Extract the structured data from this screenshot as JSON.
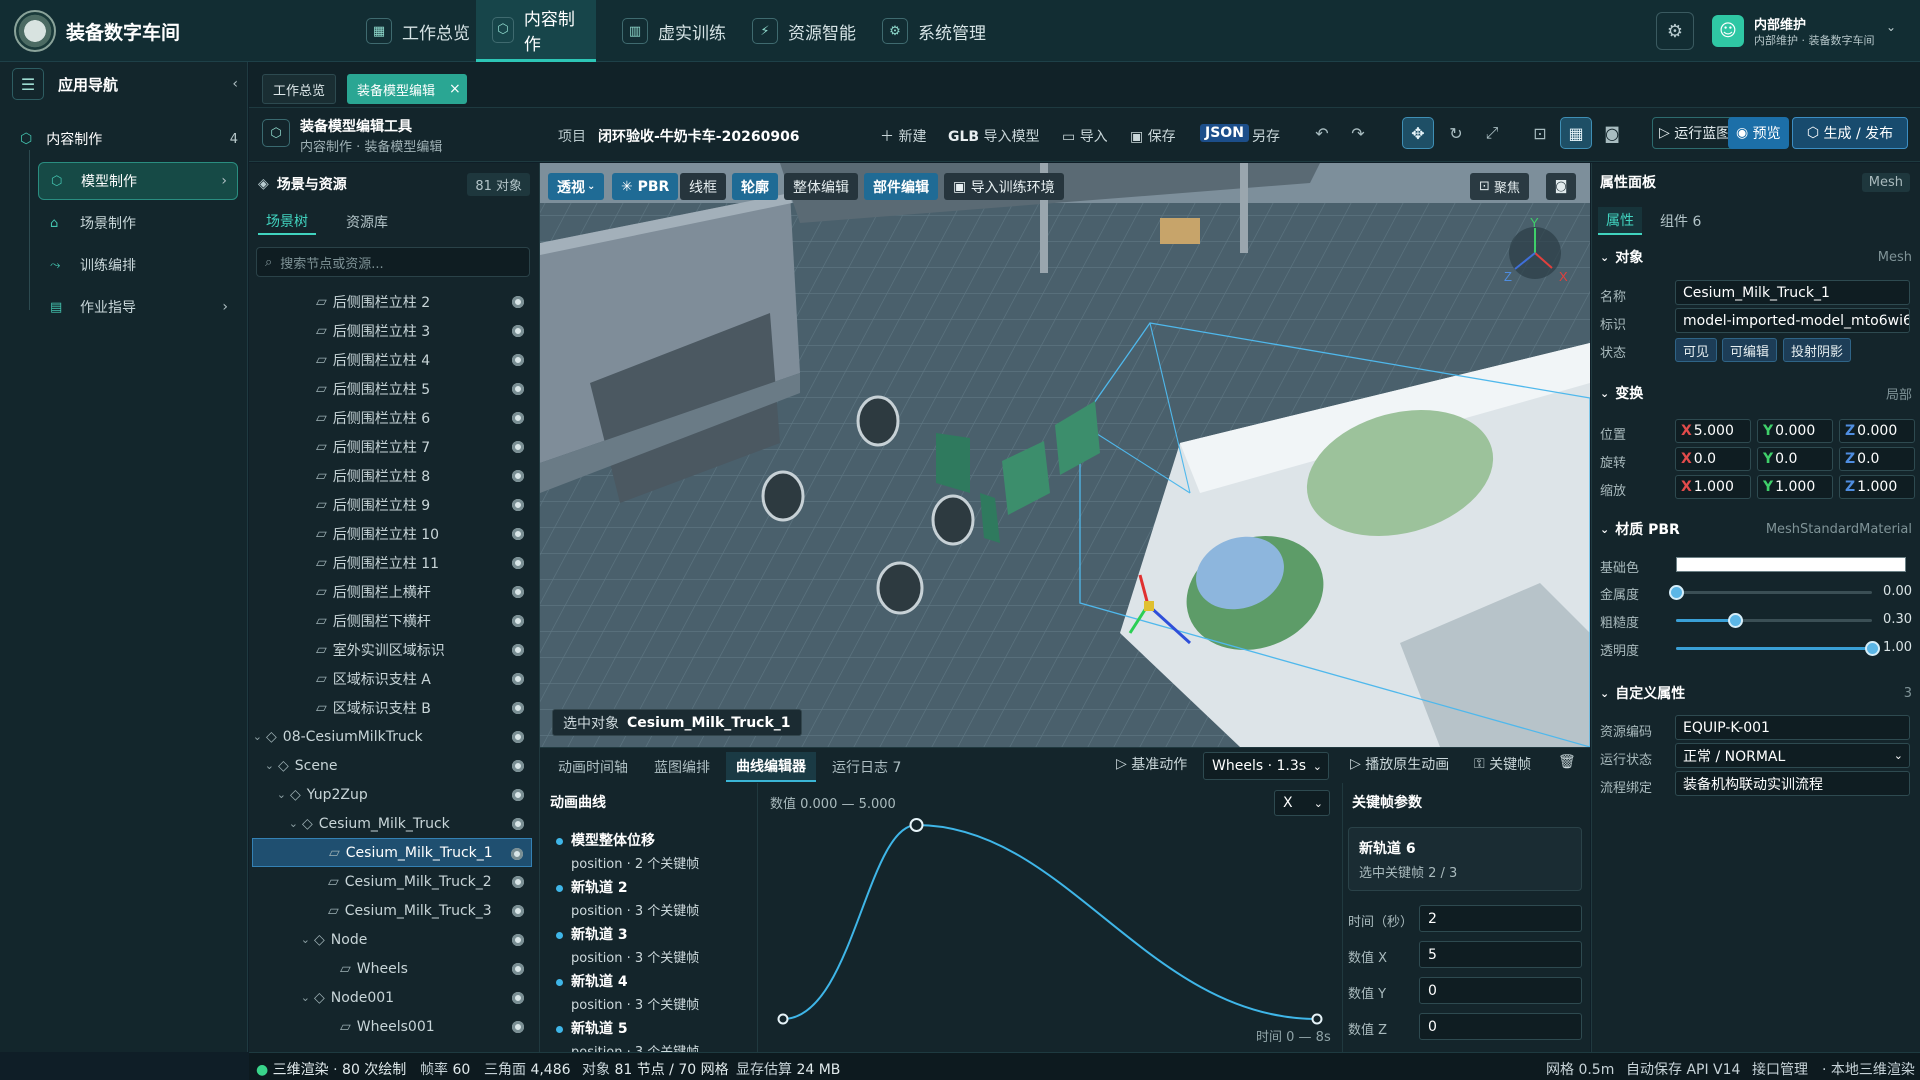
{
  "app": {
    "title": "装备数字车间"
  },
  "topnav": [
    {
      "label": "工作总览",
      "icon": "grid-icon"
    },
    {
      "label": "内容制作",
      "icon": "cube-icon",
      "active": true
    },
    {
      "label": "虚实训练",
      "icon": "book-icon"
    },
    {
      "label": "资源智能",
      "icon": "plug-icon"
    },
    {
      "label": "系统管理",
      "icon": "gear-icon"
    }
  ],
  "user": {
    "name": "内部维护",
    "subtitle": "内部维护 · 装备数字车间"
  },
  "sidebar": {
    "title": "应用导航",
    "section": {
      "label": "内容制作",
      "count": "4"
    },
    "items": [
      {
        "label": "模型制作",
        "icon": "cube-icon"
      },
      {
        "label": "场景制作",
        "icon": "bank-icon"
      },
      {
        "label": "训练编排",
        "icon": "flow-icon"
      },
      {
        "label": "作业指导",
        "icon": "document-icon"
      }
    ]
  },
  "tabs": {
    "overview": "工作总览",
    "editor": "装备模型编辑"
  },
  "toolbar": {
    "title": "装备模型编辑工具",
    "breadcrumb": "内容制作 · 装备模型编辑",
    "project_label": "项目",
    "project_name": "闭环验收-牛奶卡车-20260906",
    "new": "新建",
    "glb": "GLB",
    "import_model": "导入模型",
    "import": "导入",
    "save": "保存",
    "json": "JSON",
    "save_as": "另存",
    "run_blueprint": "运行蓝图",
    "preview": "预览",
    "publish": "生成 / 发布"
  },
  "scene": {
    "title": "场景与资源",
    "count": "81 对象",
    "tabs": [
      "场景树",
      "资源库"
    ],
    "search_placeholder": "搜索节点或资源...",
    "tree": [
      {
        "label": "后侧围栏立柱 2",
        "depth": 3,
        "icon": "▱"
      },
      {
        "label": "后侧围栏立柱 3",
        "depth": 3,
        "icon": "▱"
      },
      {
        "label": "后侧围栏立柱 4",
        "depth": 3,
        "icon": "▱"
      },
      {
        "label": "后侧围栏立柱 5",
        "depth": 3,
        "icon": "▱"
      },
      {
        "label": "后侧围栏立柱 6",
        "depth": 3,
        "icon": "▱"
      },
      {
        "label": "后侧围栏立柱 7",
        "depth": 3,
        "icon": "▱"
      },
      {
        "label": "后侧围栏立柱 8",
        "depth": 3,
        "icon": "▱"
      },
      {
        "label": "后侧围栏立柱 9",
        "depth": 3,
        "icon": "▱"
      },
      {
        "label": "后侧围栏立柱 10",
        "depth": 3,
        "icon": "▱"
      },
      {
        "label": "后侧围栏立柱 11",
        "depth": 3,
        "icon": "▱"
      },
      {
        "label": "后侧围栏上横杆",
        "depth": 3,
        "icon": "▱"
      },
      {
        "label": "后侧围栏下横杆",
        "depth": 3,
        "icon": "▱"
      },
      {
        "label": "室外实训区域标识",
        "depth": 3,
        "icon": "▱"
      },
      {
        "label": "区域标识支柱 A",
        "depth": 3,
        "icon": "▱"
      },
      {
        "label": "区域标识支柱 B",
        "depth": 3,
        "icon": "▱"
      },
      {
        "label": "08-CesiumMilkTruck",
        "depth": 0,
        "icon": "◇",
        "caret": "⌄"
      },
      {
        "label": "Scene",
        "depth": 1,
        "icon": "◇",
        "caret": "⌄"
      },
      {
        "label": "Yup2Zup",
        "depth": 2,
        "icon": "◇",
        "caret": "⌄"
      },
      {
        "label": "Cesium_Milk_Truck",
        "depth": 3,
        "icon": "◇",
        "caret": "⌄"
      },
      {
        "label": "Cesium_Milk_Truck_1",
        "depth": 4,
        "icon": "▱",
        "selected": true
      },
      {
        "label": "Cesium_Milk_Truck_2",
        "depth": 4,
        "icon": "▱"
      },
      {
        "label": "Cesium_Milk_Truck_3",
        "depth": 4,
        "icon": "▱"
      },
      {
        "label": "Node",
        "depth": 4,
        "icon": "◇",
        "caret": "⌄"
      },
      {
        "label": "Wheels",
        "depth": 5,
        "icon": "▱"
      },
      {
        "label": "Node001",
        "depth": 4,
        "icon": "◇",
        "caret": "⌄"
      },
      {
        "label": "Wheels001",
        "depth": 5,
        "icon": "▱"
      }
    ]
  },
  "viewport": {
    "buttons": [
      "透视",
      "PBR",
      "线框",
      "轮廓",
      "整体编辑",
      "部件编辑",
      "导入训练环境"
    ],
    "focus": "聚焦",
    "selected_label": "选中对象",
    "selected_name": "Cesium_Milk_Truck_1",
    "gizmo": {
      "y": "Y",
      "z": "Z",
      "x": "X"
    }
  },
  "dock": {
    "tabs": [
      "动画时间轴",
      "蓝图编排",
      "曲线编辑器",
      "运行日志 7"
    ],
    "base_action": "基准动作",
    "track_select": "Wheels · 1.3s",
    "play_native": "播放原生动画",
    "keyframe": "关键帧",
    "curves_title": "动画曲线",
    "curves": [
      {
        "name": "模型整体位移",
        "sub": "position · 2 个关键帧"
      },
      {
        "name": "新轨道 2",
        "sub": "position · 3 个关键帧"
      },
      {
        "name": "新轨道 3",
        "sub": "position · 3 个关键帧"
      },
      {
        "name": "新轨道 4",
        "sub": "position · 3 个关键帧"
      },
      {
        "name": "新轨道 5",
        "sub": "position · 3 个关键帧"
      }
    ],
    "range_label": "数值 0.000 — 5.000",
    "axis": "X",
    "time_label": "时间 0 — 8s",
    "kf_title": "关键帧参数",
    "kf_track": "新轨道 6",
    "kf_selected": "选中关键帧 2 / 3",
    "fields": [
      {
        "label": "时间（秒）",
        "value": "2"
      },
      {
        "label": "数值 X",
        "value": "5"
      },
      {
        "label": "数值 Y",
        "value": "0"
      },
      {
        "label": "数值 Z",
        "value": "0"
      }
    ]
  },
  "chart_data": {
    "type": "line",
    "x": [
      0,
      2,
      8
    ],
    "series": [
      {
        "values": [
          0,
          5,
          0
        ]
      }
    ],
    "xlim": [
      0,
      8
    ],
    "ylim": [
      0,
      5
    ]
  },
  "props": {
    "title": "属性面板",
    "mode": "Mesh",
    "tabs": [
      "属性",
      "组件 6"
    ],
    "object": {
      "title": "对象",
      "right": "Mesh",
      "name_label": "名称",
      "name": "Cesium_Milk_Truck_1",
      "id_label": "标识",
      "id": "model-imported-model_mto6wi6",
      "state_label": "状态",
      "states": [
        "可见",
        "可编辑",
        "投射阴影"
      ]
    },
    "transform": {
      "title": "变换",
      "right": "局部",
      "rows": [
        {
          "label": "位置",
          "x": "5.000",
          "y": "0.000",
          "z": "0.000"
        },
        {
          "label": "旋转",
          "x": "0.0",
          "y": "0.0",
          "z": "0.0"
        },
        {
          "label": "缩放",
          "x": "1.000",
          "y": "1.000",
          "z": "1.000"
        }
      ]
    },
    "material": {
      "title": "材质 PBR",
      "right": "MeshStandardMaterial",
      "base_color_label": "基础色",
      "base_color": "#ffffff",
      "sliders": [
        {
          "label": "金属度",
          "value": "0.00",
          "frac": 0.0
        },
        {
          "label": "粗糙度",
          "value": "0.30",
          "frac": 0.3
        },
        {
          "label": "透明度",
          "value": "1.00",
          "frac": 1.0
        }
      ]
    },
    "custom": {
      "title": "自定义属性",
      "count": "3",
      "rows": [
        {
          "label": "资源编码",
          "value": "EQUIP-K-001"
        },
        {
          "label": "运行状态",
          "value": "正常 / NORMAL"
        },
        {
          "label": "流程绑定",
          "value": "装备机构联动实训流程"
        }
      ]
    }
  },
  "status": {
    "render": "三维渲染",
    "draws": "80 次绘制",
    "fps_label": "帧率",
    "fps": "60",
    "tri_label": "三角面",
    "tris": "4,486",
    "obj_label": "对象",
    "objs": "81 节点 / 70 网格",
    "mem_label": "显存估算",
    "mem": "24 MB",
    "grid": "网格 0.5m",
    "autosave": "自动保存 API V14",
    "api": "接口管理",
    "local": "本地三维渲染"
  }
}
